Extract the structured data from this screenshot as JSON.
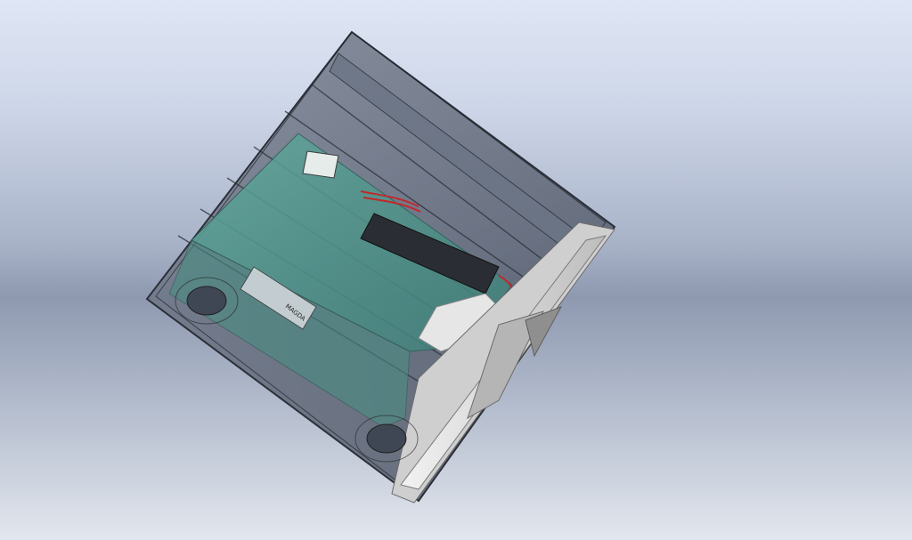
{
  "viewport": {
    "background_top": "#dfe6f5",
    "background_mid": "#8e99b0",
    "background_bottom": "#e3e7ee"
  },
  "model": {
    "part_label": "MAGDA",
    "colors": {
      "shell": "#5d6677",
      "shell_edge": "#2b2f38",
      "board": "#4f9a8f",
      "end_cap": "#e6e6e6",
      "end_cap_shadow": "#9a9a9a",
      "wire_red": "#c2282a",
      "battery": "#2a2d33"
    }
  }
}
